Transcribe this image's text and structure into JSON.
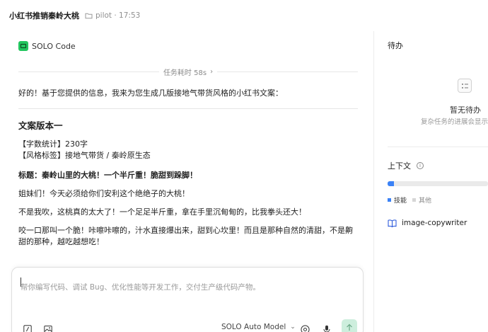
{
  "header": {
    "title": "小红书推销秦岭大桃",
    "meta": "pilot · 17:53"
  },
  "agent": {
    "name": "SOLO Code",
    "duration": "任务耗时 58s"
  },
  "message": {
    "intro": "好的！基于您提供的信息，我来为您生成几版接地气带货风格的小红书文案：",
    "heading": "文案版本一",
    "word_count": "【字数统计】230字",
    "style_tag": "【风格标签】接地气带货 / 秦岭原生态",
    "title_line": "标题：秦岭山里的大桃！一个半斤重！脆甜到跺脚！",
    "paragraphs": [
      "姐妹们！今天必须给你们安利这个绝绝子的大桃！",
      "不是我吹，这桃真的太大了！一个足足半斤重，拿在手里沉甸甸的，比我拳头还大！",
      "咬一口那叫一个脆！咔嚓咔嚓的，汁水直接爆出来，甜到心坎里！而且是那种自然的清甜，不是齁甜的那种，越吃越想吃！"
    ]
  },
  "composer": {
    "placeholder": "帮你编写代码、调试 Bug、优化性能等开发工作，交付生产级代码产物。",
    "model": "SOLO Auto Model"
  },
  "todo": {
    "title": "待办",
    "empty": "暂无待办",
    "hint": "复杂任务的进展会显示"
  },
  "context": {
    "title": "上下文",
    "usage_fraction": 0.06,
    "legend": {
      "skills": "技能",
      "other": "其他"
    },
    "skill_item": "image-copywriter"
  },
  "colors": {
    "accent_green": "#22c55e",
    "accent_blue": "#3b82f6",
    "send_bg": "#cdeedd"
  }
}
